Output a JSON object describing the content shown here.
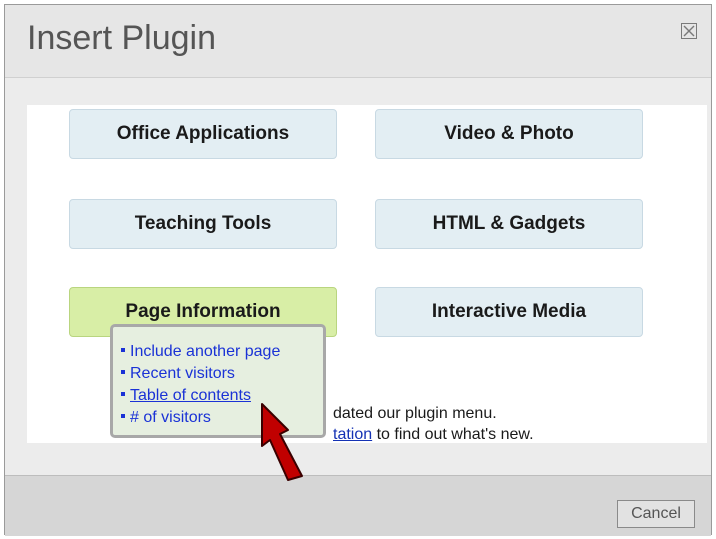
{
  "dialog": {
    "title": "Insert Plugin",
    "close_icon": "close-box-icon"
  },
  "plugins": [
    {
      "label": "Office Applications"
    },
    {
      "label": "Video & Photo"
    },
    {
      "label": "Teaching Tools"
    },
    {
      "label": "HTML & Gadgets"
    },
    {
      "label": "Page Information",
      "active": true
    },
    {
      "label": "Interactive Media"
    }
  ],
  "notice": {
    "line1_visible": "dated our plugin menu.",
    "link_visible": "tation",
    "line2_rest": " to find out what's new."
  },
  "submenu": {
    "items": [
      {
        "label": "Include another page"
      },
      {
        "label": "Recent visitors"
      },
      {
        "label": "Table of contents"
      },
      {
        "label": "# of visitors"
      }
    ]
  },
  "footer": {
    "cancel_label": "Cancel"
  },
  "annotation": {
    "arrow_color": "#c00000",
    "arrow_icon": "red-arrow-icon"
  },
  "colors": {
    "active_plugin_bg": "#d8eea6",
    "plugin_bg": "#e3eef3",
    "link": "#1a32d6"
  }
}
